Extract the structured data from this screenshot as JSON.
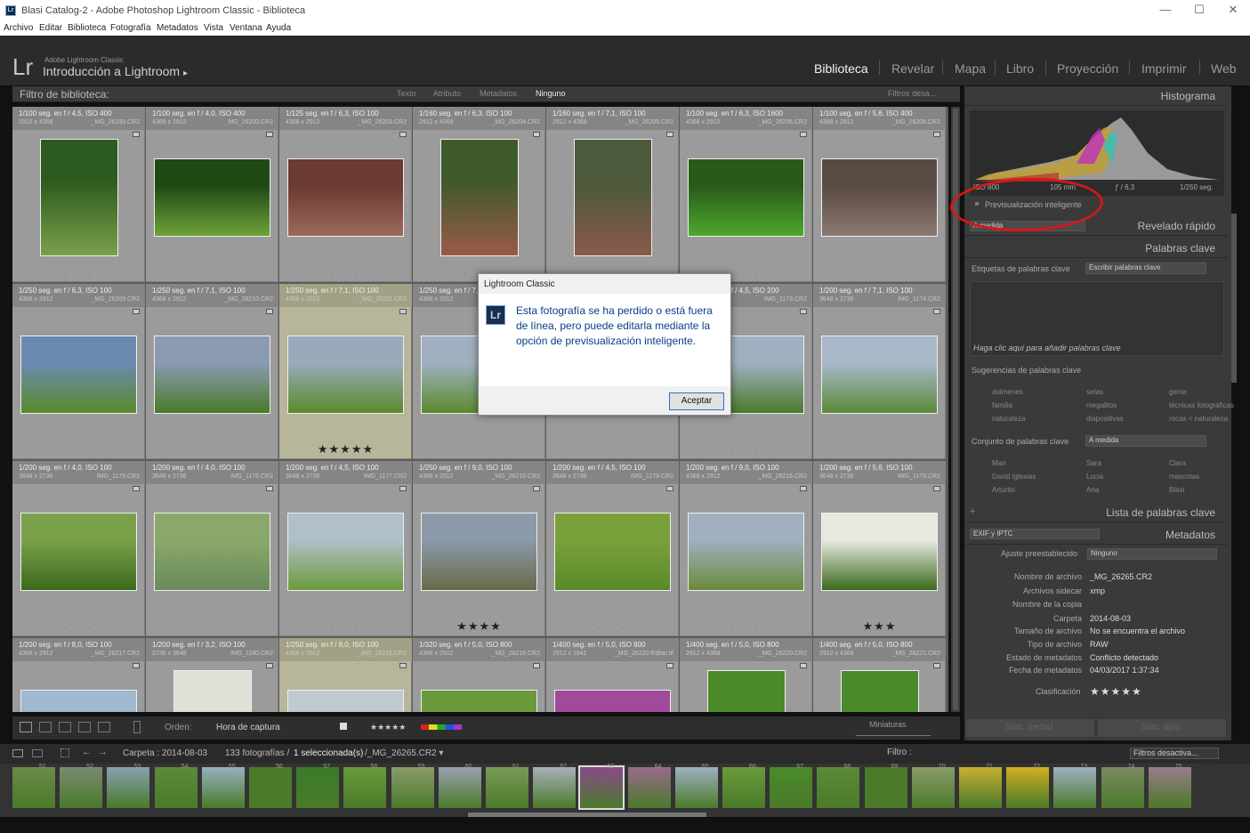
{
  "window": {
    "title": "Blasi Catalog-2 - Adobe Photoshop Lightroom Classic - Biblioteca",
    "app_icon": "Lr",
    "minimize": "—",
    "maximize": "☐",
    "close": "✕"
  },
  "menu": [
    "Archivo",
    "Editar",
    "Biblioteca",
    "Fotografía",
    "Metadatos",
    "Vista",
    "Ventana",
    "Ayuda"
  ],
  "identity": {
    "logo": "Lr",
    "small": "Adobe Lightroom Classic",
    "title": "Introducción a Lightroom",
    "arrow": "▸"
  },
  "modules": [
    "Biblioteca",
    "Revelar",
    "Mapa",
    "Libro",
    "Proyección",
    "Imprimir",
    "Web"
  ],
  "filter": {
    "label": "Filtro de biblioteca:",
    "tabs": [
      "Texto",
      "Atributo",
      "Metadatos",
      "Ninguno"
    ],
    "preset": "Filtros desa..."
  },
  "grid": [
    [
      {
        "exp": "1/100 seg. en f / 4,5, ISO 400",
        "dim": "2912 x 4368",
        "file": "_MG_26199.CR2",
        "rating": "dots",
        "c": [
          "#2d5a1e",
          "#7aa04a"
        ]
      },
      {
        "exp": "1/100 seg. en f / 4,0, ISO 400",
        "dim": "4368 x 2912",
        "file": "_MG_26200.CR2",
        "rating": "dots",
        "c": [
          "#1f4a14",
          "#6ea23a"
        ]
      },
      {
        "exp": "1/125 seg. en f / 6,3, ISO 100",
        "dim": "4368 x 2912",
        "file": "_MG_26203.CR2",
        "rating": "dots",
        "c": [
          "#6b3a32",
          "#9c6a5a"
        ]
      },
      {
        "exp": "1/160 seg. en f / 6,3, ISO 100",
        "dim": "2912 x 4368",
        "file": "_MG_26204.CR2",
        "rating": "dots",
        "c": [
          "#3e5a2a",
          "#9a5a48"
        ]
      },
      {
        "exp": "1/160 seg. en f / 7,1, ISO 100",
        "dim": "2912 x 4368",
        "file": "_MG_26205.CR2",
        "rating": "dots",
        "c": [
          "#4a5a3a",
          "#8a5a4a"
        ]
      },
      {
        "exp": "1/100 seg. en f / 6,3, ISO 1600",
        "dim": "4368 x 2912",
        "file": "_MG_26206.CR2",
        "rating": "dots",
        "c": [
          "#2a5a1a",
          "#4ea82e"
        ]
      },
      {
        "exp": "1/100 seg. en f / 5,6, ISO 400",
        "dim": "4368 x 2912",
        "file": "_MG_26208.CR2",
        "rating": "dots",
        "c": [
          "#5a4a44",
          "#8a7a70"
        ]
      }
    ],
    [
      {
        "exp": "1/250 seg. en f / 6,3, ISO 100",
        "dim": "4368 x 2912",
        "file": "_MG_26209.CR2",
        "rating": "dots",
        "c": [
          "#6a8ab0",
          "#5a8a2a"
        ]
      },
      {
        "exp": "1/250 seg. en f / 7,1, ISO 100",
        "dim": "4368 x 2912",
        "file": "_MG_26210.CR2",
        "rating": "dots",
        "c": [
          "#8a9ab0",
          "#4a7a2a"
        ]
      },
      {
        "exp": "1/250 seg. en f / 7,1, ISO 100",
        "dim": "4368 x 2912",
        "file": "_MG_26211.CR2",
        "rating": "★★★★★",
        "c": [
          "#9aaabb",
          "#5a8a2a"
        ],
        "sel": true
      },
      {
        "exp": "1/250 seg. en f / 7,1, ISO 100",
        "dim": "4368 x 2912",
        "file": "_MG_26212.CR2",
        "rating": "dots",
        "c": [
          "#a0b0c0",
          "#5a8a2a"
        ]
      },
      {
        "exp": "1/250 seg. en f / 4,5, ISO 200",
        "dim": "4368 x 2912",
        "file": "IMG_1172.CR2",
        "rating": "dots",
        "c": [
          "#6a7a50",
          "#4a6a2a"
        ]
      },
      {
        "exp": "1/250 seg. en f / 4,5, ISO 200",
        "dim": "4368 x 2912",
        "file": "IMG_1173.CR2",
        "rating": "dots",
        "c": [
          "#a0b0c0",
          "#4a7a2a"
        ]
      },
      {
        "exp": "1/200 seg. en f / 7,1, ISO 100",
        "dim": "3648 x 2736",
        "file": "IMG_1174.CR2",
        "rating": "dots",
        "c": [
          "#a8b8c8",
          "#5a8a3a"
        ]
      }
    ],
    [
      {
        "exp": "1/200 seg. en f / 4,0, ISO 100",
        "dim": "3648 x 2736",
        "file": "IMG_1175.CR2",
        "rating": "dots",
        "c": [
          "#7aa04a",
          "#3a6a1a"
        ]
      },
      {
        "exp": "1/200 seg. en f / 4,0, ISO 100",
        "dim": "3648 x 2736",
        "file": "IMG_1176.CR2",
        "rating": "dots",
        "c": [
          "#8aa86a",
          "#6a8a5a"
        ]
      },
      {
        "exp": "1/200 seg. en f / 4,5, ISO 100",
        "dim": "3648 x 2736",
        "file": "IMG_1177.CR2",
        "rating": "dots",
        "c": [
          "#b0c0c8",
          "#6a9a3a"
        ]
      },
      {
        "exp": "1/250 seg. en f / 9,0, ISO 100",
        "dim": "4368 x 2912",
        "file": "_MG_26215.CR2",
        "rating": "★★★★",
        "c": [
          "#8a9aa8",
          "#6a6a4a"
        ]
      },
      {
        "exp": "1/200 seg. en f / 4,5, ISO 100",
        "dim": "3648 x 2736",
        "file": "IMG_1178.CR2",
        "rating": "dots",
        "c": [
          "#7aa03a",
          "#5a8a2a"
        ]
      },
      {
        "exp": "1/200 seg. en f / 9,0, ISO 100",
        "dim": "4368 x 2912",
        "file": "_MG_26216.CR2",
        "rating": "dots",
        "c": [
          "#a0b0c0",
          "#6a8a3a"
        ]
      },
      {
        "exp": "1/200 seg. en f / 5,6, ISO 100",
        "dim": "3648 x 2736",
        "file": "IMG_1179.CR2",
        "rating": "★★★",
        "c": [
          "#e8e8e0",
          "#3a6a1a"
        ]
      }
    ],
    [
      {
        "exp": "1/200 seg. en f / 8,0, ISO 100",
        "dim": "4368 x 2912",
        "file": "_MG_26217.CR2",
        "rating": "dots",
        "c": [
          "#a0b8d0",
          "#6a8a3a"
        ]
      },
      {
        "exp": "1/200 seg. en f / 3,2, ISO 100",
        "dim": "2736 x 3648",
        "file": "IMG_1180.CR2",
        "rating": "dots",
        "c": [
          "#e0e0d8",
          "#4a8a2a"
        ]
      },
      {
        "exp": "1/250 seg. en f / 8,0, ISO 100",
        "dim": "4368 x 2912",
        "file": "_MG_26218.CR2",
        "rating": "dots",
        "c": [
          "#c0c8d0",
          "#6a8a3a"
        ],
        "sel": true
      },
      {
        "exp": "1/320 seg. en f / 5,0, ISO 800",
        "dim": "4368 x 2912",
        "file": "_MG_26219.CR2",
        "rating": "dots",
        "c": [
          "#6a9a3a",
          "#a04a9a"
        ]
      },
      {
        "exp": "1/400 seg. en f / 5,0, ISO 800",
        "dim": "2912 x 1941",
        "file": "_MG_26220-Editar.tif",
        "rating": "dots",
        "c": [
          "#a04a9a",
          "#4a8a2a"
        ]
      },
      {
        "exp": "1/400 seg. en f / 5,0, ISO 800",
        "dim": "2912 x 4368",
        "file": "_MG_26220.CR2",
        "rating": "dots",
        "c": [
          "#4a8a2a",
          "#a04a9a"
        ]
      },
      {
        "exp": "1/400 seg. en f / 5,0, ISO 800",
        "dim": "2912 x 4368",
        "file": "_MG_26221.CR2",
        "rating": "dots",
        "c": [
          "#4a8a2a",
          "#8a4a8a"
        ]
      }
    ]
  ],
  "toolbar": {
    "orden_label": "Orden:",
    "orden_value": "Hora de captura",
    "stars": "★★★★★",
    "thumbs_label": "Miniaturas"
  },
  "histogram": {
    "title": "Histograma",
    "iso": "ISO 800",
    "focal": "105 mm",
    "fstop": "ƒ / 6,3",
    "speed": "1/250 seg.",
    "smart_preview": "Previsualización inteligente"
  },
  "quick_develop": {
    "title": "Revelado rápido",
    "preset": "A medida"
  },
  "keywords": {
    "title": "Palabras clave",
    "tags_label": "Etiquetas de palabras clave",
    "tags_value": "Escribir palabras clave",
    "click_hint": "Haga clic aquí para añadir palabras clave",
    "suggestions_title": "Sugerencias de palabras clave",
    "suggestions": [
      "dolmenes",
      "setas",
      "gente",
      "familia",
      "megalitos",
      "técnicas fotográficas",
      "naturaleza",
      "diapositivas",
      "rocas < naturaleza"
    ],
    "set_label": "Conjunto de palabras clave",
    "set_value": "A medida",
    "set": [
      "Mari",
      "Sara",
      "Clara",
      "David iglesias",
      "Lucia",
      "mascotas",
      "Arturito",
      "Ana",
      "Blasi"
    ]
  },
  "keyword_list": {
    "title": "Lista de palabras clave",
    "plus": "+"
  },
  "metadata": {
    "title": "Metadatos",
    "preset_dropdown": "EXIF y IPTC",
    "preset_label": "Ajuste preestablecido",
    "preset_value": "Ninguno",
    "rows": [
      {
        "k": "Nombre de archivo",
        "v": "_MG_26265.CR2"
      },
      {
        "k": "Archivos sidecar",
        "v": "xmp"
      },
      {
        "k": "Nombre de la copia",
        "v": ""
      },
      {
        "k": "Carpeta",
        "v": "2014-08-03"
      },
      {
        "k": "Tamaño de archivo",
        "v": "No se encuentra el archivo"
      },
      {
        "k": "Tipo de archivo",
        "v": "RAW"
      },
      {
        "k": "Estado de metadatos",
        "v": "Conflicto detectado"
      },
      {
        "k": "Fecha de metadatos",
        "v": "04/03/2017 1:37:34"
      }
    ],
    "rating_label": "Clasificación",
    "rating": "★★★★★"
  },
  "sync": {
    "metadata": "Sinc. metad.",
    "settings": "Sinc. ajus."
  },
  "filmstrip": {
    "folder": "Carpeta : 2014-08-03",
    "count": "133 fotografías /",
    "selected": "1 seleccionada(s)",
    "file": "/_MG_26265.CR2 ▾",
    "filter_label": "Filtro :",
    "filter_value": "Filtros desactiva...",
    "nums": [
      "51",
      "52",
      "53",
      "54",
      "55",
      "56",
      "57",
      "58",
      "59",
      "60",
      "61",
      "62",
      "63",
      "64",
      "65",
      "66",
      "67",
      "68",
      "69",
      "70",
      "71",
      "72",
      "73",
      "74",
      "75"
    ],
    "colors": [
      "#6a8a4a",
      "#7a8a70",
      "#8aa0b0",
      "#5a8a3a",
      "#9ab0c0",
      "#4a7a2a",
      "#3a7a2a",
      "#6a9a3a",
      "#8a9a6a",
      "#9aa0b0",
      "#7a9a5a",
      "#a8b0b8",
      "#8a4a8a",
      "#9a6a8a",
      "#a0b0c0",
      "#6a9a3a",
      "#4a8a2a",
      "#5a8a3a",
      "#4a7a2a",
      "#8a9a6a",
      "#c8b030",
      "#d0b020",
      "#a0b0c0",
      "#7a8a60",
      "#9a7a8a"
    ]
  },
  "dialog": {
    "title": "Lightroom Classic",
    "icon": "Lr",
    "message": "Esta fotografía se ha perdido o está fuera de línea, pero puede editarla mediante la opción de previsualización inteligente.",
    "ok": "Aceptar"
  }
}
